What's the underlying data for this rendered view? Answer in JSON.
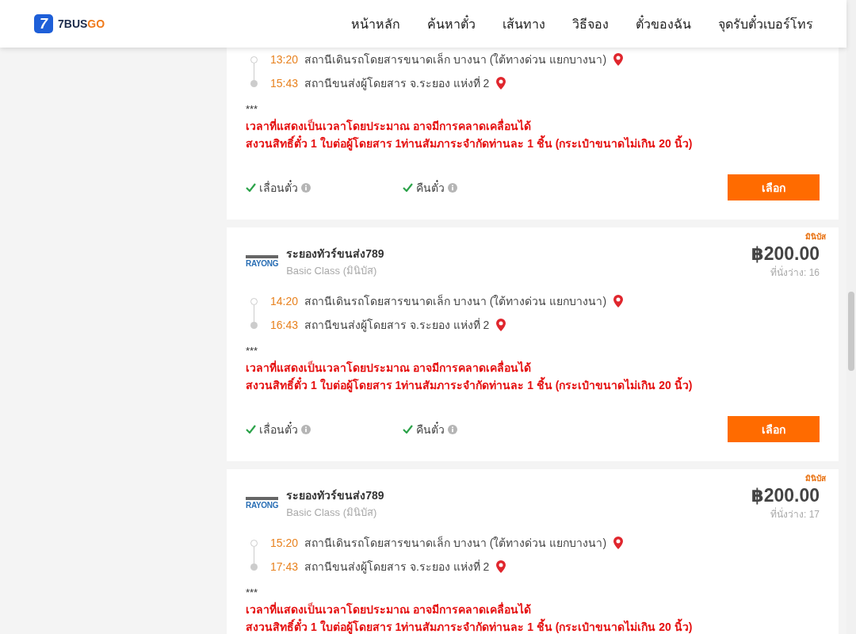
{
  "header": {
    "logo": {
      "mark": "7",
      "name_a": "7BUS",
      "name_b": "GO"
    },
    "nav": [
      "หน้าหลัก",
      "ค้นหาตั๋ว",
      "เส้นทาง",
      "วิธีจอง",
      "ตั๋วของฉัน",
      "จุดรับตั๋วเบอร์โทร"
    ]
  },
  "trips": [
    {
      "stops": [
        {
          "kind": "departure",
          "time": "13:20",
          "place": "สถานีเดินรถโดยสารขนาดเล็ก บางนา (ใต้ทางด่วน แยกบางนา)"
        },
        {
          "kind": "arrival",
          "time": "15:43",
          "place": "สถานีขนส่งผู้โดยสาร จ.ระยอง แห่งที่ 2"
        }
      ],
      "note_mark": "***",
      "notes": [
        "เวลาที่แสดงเป็นเวลาโดยประมาณ อาจมีการคลาดเคลื่อนได้",
        "สงวนสิทธิ์ตั๋ว 1 ใบต่อผู้โดยสาร 1ท่านสัมภาระจำกัดท่านละ 1 ชิ้น (กระเป๋าขนาดไม่เกิน 20 นิ้ว)"
      ],
      "features": [
        {
          "label": "เลื่อนตั๋ว",
          "available": true
        },
        {
          "label": "คืนตั๋ว",
          "available": true
        }
      ],
      "button": "เลือก"
    },
    {
      "badge": "มินิบัส",
      "logo_text": "RAYONG",
      "operator": "ระยองทัวร์ขนส่ง789",
      "class": "Basic Class (มินิบัส)",
      "price": "฿200.00",
      "seats": "ที่นั่งว่าง: 16",
      "stops": [
        {
          "kind": "departure",
          "time": "14:20",
          "place": "สถานีเดินรถโดยสารขนาดเล็ก บางนา (ใต้ทางด่วน แยกบางนา)"
        },
        {
          "kind": "arrival",
          "time": "16:43",
          "place": "สถานีขนส่งผู้โดยสาร จ.ระยอง แห่งที่ 2"
        }
      ],
      "note_mark": "***",
      "notes": [
        "เวลาที่แสดงเป็นเวลาโดยประมาณ อาจมีการคลาดเคลื่อนได้",
        "สงวนสิทธิ์ตั๋ว 1 ใบต่อผู้โดยสาร 1ท่านสัมภาระจำกัดท่านละ 1 ชิ้น (กระเป๋าขนาดไม่เกิน 20 นิ้ว)"
      ],
      "features": [
        {
          "label": "เลื่อนตั๋ว",
          "available": true
        },
        {
          "label": "คืนตั๋ว",
          "available": true
        }
      ],
      "button": "เลือก"
    },
    {
      "badge": "มินิบัส",
      "logo_text": "RAYONG",
      "operator": "ระยองทัวร์ขนส่ง789",
      "class": "Basic Class (มินิบัส)",
      "price": "฿200.00",
      "seats": "ที่นั่งว่าง: 17",
      "stops": [
        {
          "kind": "departure",
          "time": "15:20",
          "place": "สถานีเดินรถโดยสารขนาดเล็ก บางนา (ใต้ทางด่วน แยกบางนา)"
        },
        {
          "kind": "arrival",
          "time": "17:43",
          "place": "สถานีขนส่งผู้โดยสาร จ.ระยอง แห่งที่ 2"
        }
      ],
      "note_mark": "***",
      "notes": [
        "เวลาที่แสดงเป็นเวลาโดยประมาณ อาจมีการคลาดเคลื่อนได้",
        "สงวนสิทธิ์ตั๋ว 1 ใบต่อผู้โดยสาร 1ท่านสัมภาระจำกัดท่านละ 1 ชิ้น (กระเป๋าขนาดไม่เกิน 20 นิ้ว)"
      ]
    }
  ]
}
